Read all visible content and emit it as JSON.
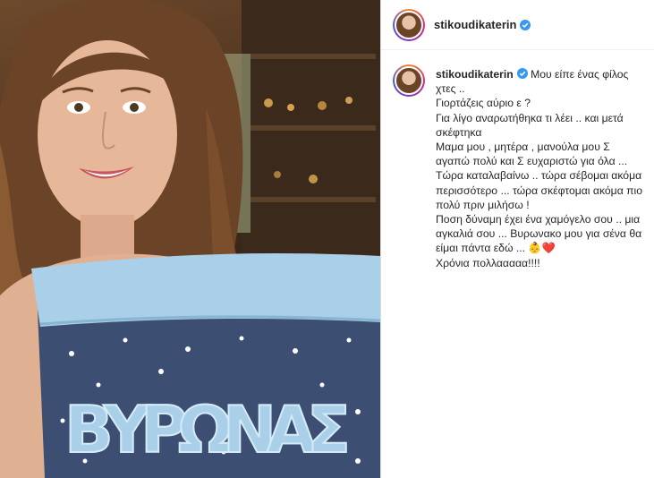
{
  "post": {
    "username": "stikoudikaterin",
    "verified": true,
    "caption_first": "Μου είπε ένας φίλος χτες ..",
    "caption_lines": [
      "Γιορτάζεις αύριο ε ?",
      "Για λίγο αναρωτήθηκα τι λέει .. και μετά σκέφτηκα",
      "Μαμα μου , μητέρα , μανούλα μου Σ αγαπώ πολύ και Σ ευχαριστώ για όλα ...",
      "Τώρα καταλαβαίνω .. τώρα σέβομαι ακόμα περισσότερο ... τώρα σκέφτομαι ακόμα πιο πολύ πριν μιλήσω !",
      "Ποση δύναμη έχει ένα χαμόγελο σου .. μια αγκαλιά σου ... Βυρωνακο μου για σένα θα είμαι πάντα εδώ ... 👶❤️",
      "Χρόνια πολλααααα!!!!"
    ],
    "basket_text": "ΒΥΡΩΝΑΣ",
    "colors": {
      "verified": "#3897f0",
      "basket": "#3c4e72",
      "lining": "#a9d0e8"
    }
  }
}
